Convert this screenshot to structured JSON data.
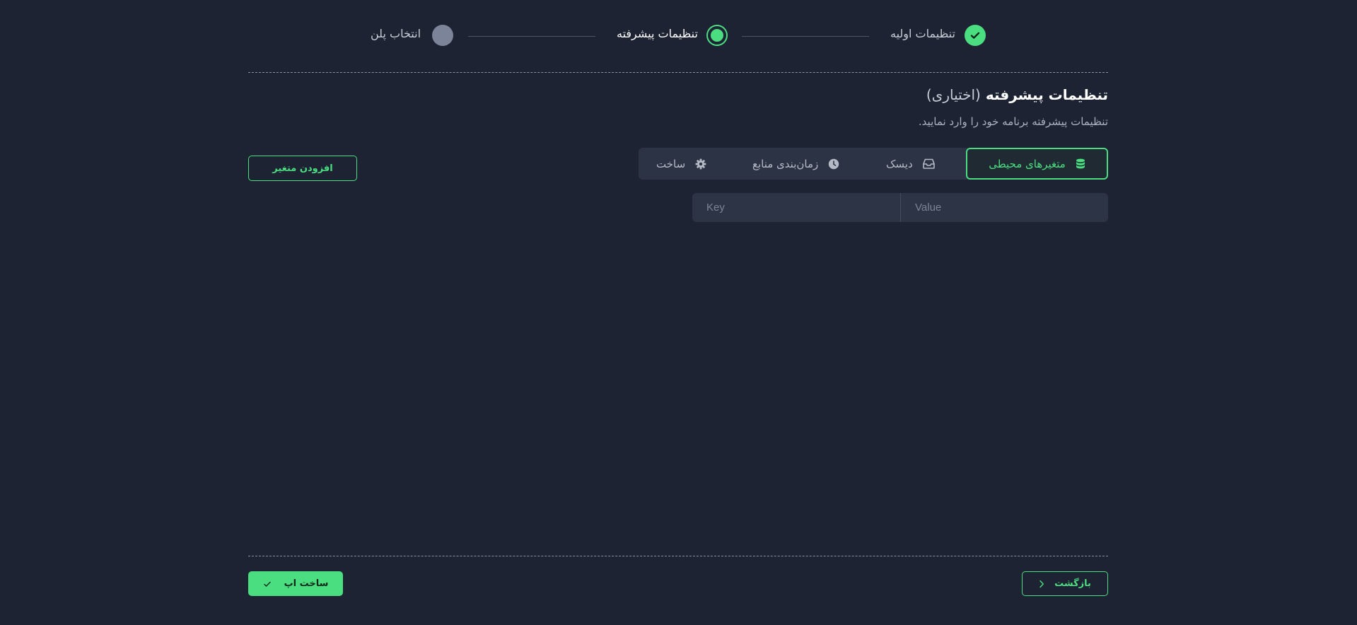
{
  "stepper": {
    "steps": [
      {
        "label": "تنظیمات اولیه",
        "state": "done"
      },
      {
        "label": "تنظیمات پیشرفته",
        "state": "current"
      },
      {
        "label": "انتخاب پلن",
        "state": "pending"
      }
    ]
  },
  "section": {
    "title": "تنظیمات پیشرفته",
    "title_optional": "(اختیاری)",
    "subtitle": "تنظیمات پیشرفته برنامه خود را وارد نمایید."
  },
  "tabs": [
    {
      "label": "متغیرهای محیطی",
      "icon": "database-icon",
      "active": true
    },
    {
      "label": "دیسک",
      "icon": "inbox-icon",
      "active": false
    },
    {
      "label": "زمان‌بندی منابع",
      "icon": "clock-icon",
      "active": false
    },
    {
      "label": "ساخت",
      "icon": "gear-icon",
      "active": false
    }
  ],
  "env": {
    "key_placeholder": "Key",
    "value_placeholder": "Value",
    "add_button": "افزودن متغیر"
  },
  "footer": {
    "back_label": "بازگشت",
    "create_label": "ساخت اپ"
  },
  "colors": {
    "background": "#1d2333",
    "accent": "#4ade80",
    "panel": "#2c3344"
  }
}
